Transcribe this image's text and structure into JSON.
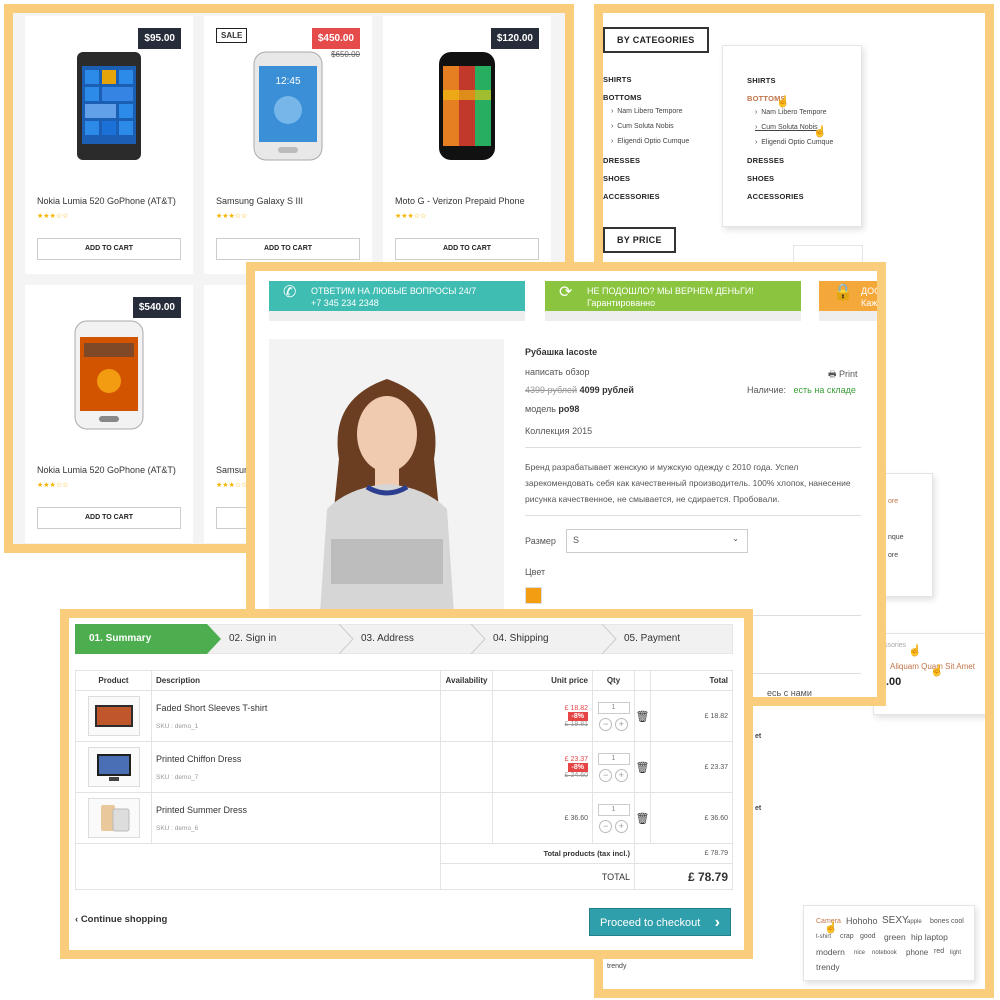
{
  "product_grid": {
    "cart_label": "ADD TO CART",
    "products": [
      {
        "name": "Nokia Lumia 520 GoPhone (AT&T)",
        "price": "$95.00",
        "rating": "★★★☆☆"
      },
      {
        "name": "Samsung Galaxy S III",
        "price": "$450.00",
        "old_price": "$650.00",
        "badge": "SALE",
        "rating": "★★★☆☆"
      },
      {
        "name": "Moto G - Verizon Prepaid Phone",
        "price": "$120.00",
        "rating": "★★★☆☆"
      },
      {
        "name": "Nokia Lumia 520 GoPhone (AT&T)",
        "price": "$540.00",
        "rating": "★★★☆☆"
      },
      {
        "name": "Samsung",
        "rating": "★★★☆☆"
      }
    ]
  },
  "category_menu": {
    "by_categories": "BY CATEGORIES",
    "by_price": "BY PRICE",
    "shirts": "SHIRTS",
    "bottoms": "BOTTOMS",
    "bottoms_popup": "BOTTOMS",
    "sub1": "Nam Libero Tempore",
    "sub2": "Cum Soluta Nobis",
    "sub3": "Eligendi Optio Cumque",
    "dresses": "DRESSES",
    "shoes": "SHOES",
    "accessories": "ACCESSORIES",
    "frag_ore": "ore",
    "frag_nque": "nque",
    "frag_ore2": "ore",
    "frag_sories": "ssories",
    "item_name": "Aliquam Quam Sit Amet",
    "item_price": ".00",
    "frag_et1": "et",
    "frag_et2": "et",
    "frag_trendy": "trendy",
    "tags": [
      "Camera",
      "Hohoho",
      "SEXY",
      "apple",
      "bones cool",
      "t-shirt",
      "crap",
      "good",
      "green",
      "hip laptop",
      "modern",
      "nice",
      "notebook",
      "phone",
      "red",
      "light",
      "trendy"
    ]
  },
  "product_detail": {
    "bar1_title": "ОТВЕТИМ НА ЛЮБЫЕ ВОПРОСЫ 24/7",
    "bar1_sub": "+7 345 234 2348",
    "bar2_title": "НЕ ПОДОШЛО? МЫ ВЕРНЕМ ДЕНЬГИ!",
    "bar2_sub": "Гарантированно",
    "bar3_title": "ДОС",
    "bar3_sub": "Каж",
    "title": "Рубашка lacoste",
    "review": "написать обзор",
    "print": "Print",
    "old_price": "4399 рублей",
    "price": "4099 рублей",
    "availability_label": "Наличие:",
    "availability_value": "есть на складе",
    "model_label": "модель",
    "model_value": "po98",
    "collection_label": "Коллекция",
    "collection_value": "2015",
    "description": "Бренд разрабатывает женскую и мужскую одежду с 2010 года. Успел зарекомендовать себя как качественный производитель. 100% хлопок, нанесение рисунка качественное, не смывается, не сдирается. Пробовали.",
    "size_label": "Размер",
    "size_value": "S",
    "color_label": "Цвет",
    "contact_fragment": "есь с нами",
    "colors": {
      "swatch": "#f29d12"
    }
  },
  "cart": {
    "steps": [
      "01. Summary",
      "02. Sign in",
      "03. Address",
      "04. Shipping",
      "05. Payment"
    ],
    "headers": [
      "Product",
      "Description",
      "Availability",
      "Unit price",
      "Qty",
      "Total"
    ],
    "sku_prefix": "SKU :",
    "rows": [
      {
        "name": "Faded Short Sleeves T-shirt",
        "sku": "demo_1",
        "price": "£ 18.82",
        "discount": "-8%",
        "old_price": "£ 19.81",
        "qty": "1",
        "total": "£ 18.82"
      },
      {
        "name": "Printed Chiffon Dress",
        "sku": "demo_7",
        "price": "£ 23.37",
        "discount": "-8%",
        "old_price": "£ 24.60",
        "qty": "1",
        "total": "£ 23.37"
      },
      {
        "name": "Printed Summer Dress",
        "sku": "demo_6",
        "price": "£ 36.60",
        "qty": "1",
        "total": "£ 36.60"
      }
    ],
    "total_products_label": "Total products (tax incl.)",
    "total_products_value": "£ 78.79",
    "total_label": "TOTAL",
    "total_value": "£ 78.79",
    "continue_label": "Continue shopping",
    "checkout_label": "Proceed to checkout"
  }
}
